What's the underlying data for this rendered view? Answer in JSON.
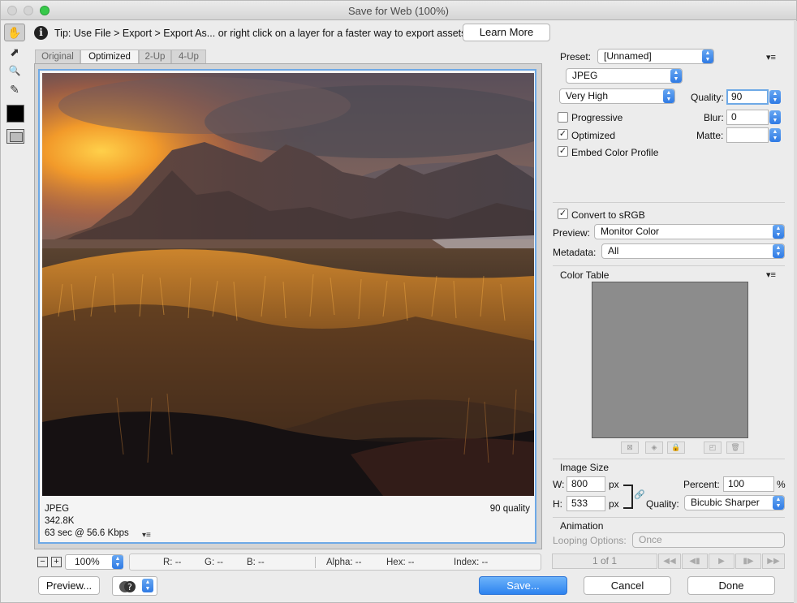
{
  "window": {
    "title": "Save for Web (100%)"
  },
  "tools": [
    {
      "name": "hand-tool",
      "glyph": "✋"
    },
    {
      "name": "slice-select-tool",
      "glyph": "⬈"
    },
    {
      "name": "zoom-tool",
      "glyph": "🔍"
    },
    {
      "name": "eyedropper-tool",
      "glyph": "✎"
    }
  ],
  "tip": {
    "icon": "i",
    "text": "Tip: Use File > Export > Export As...  or right click on a layer for a faster way to export assets",
    "button": "Learn More"
  },
  "tabs": [
    "Original",
    "Optimized",
    "2-Up",
    "4-Up"
  ],
  "selected_tab": "Optimized",
  "image_info": {
    "format": "JPEG",
    "size": "342.8K",
    "time": "63 sec @ 56.6 Kbps",
    "quality": "90 quality",
    "menu_glyph": "▾≡"
  },
  "status": {
    "zoom_minus": "−",
    "zoom_plus": "+",
    "zoom": "100%",
    "r": "R: --",
    "g": "G: --",
    "b": "B: --",
    "alpha": "Alpha: --",
    "hex": "Hex: --",
    "index": "Index: --"
  },
  "buttons": {
    "preview": "Preview...",
    "save": "Save...",
    "cancel": "Cancel",
    "done": "Done"
  },
  "settings": {
    "preset_label": "Preset:",
    "preset_value": "[Unnamed]",
    "format": "JPEG",
    "quality_preset": "Very High",
    "quality_label": "Quality:",
    "quality_value": "90",
    "progressive_label": "Progressive",
    "progressive": false,
    "blur_label": "Blur:",
    "blur_value": "0",
    "optimized_label": "Optimized",
    "optimized": true,
    "matte_label": "Matte:",
    "matte_value": "",
    "embed_profile_label": "Embed Color Profile",
    "embed_profile": true,
    "convert_srgb_label": "Convert to sRGB",
    "convert_srgb": true,
    "preview_label": "Preview:",
    "preview_value": "Monitor Color",
    "metadata_label": "Metadata:",
    "metadata_value": "All",
    "menu_glyph": "▾≡"
  },
  "color_table": {
    "title": "Color Table",
    "icons": [
      "⊠",
      "◈",
      "🔒",
      "◰",
      "🗑"
    ]
  },
  "image_size": {
    "title": "Image Size",
    "w_label": "W:",
    "w_value": "800",
    "h_label": "H:",
    "h_value": "533",
    "unit": "px",
    "percent_label": "Percent:",
    "percent_value": "100",
    "percent_unit": "%",
    "quality_label": "Quality:",
    "quality_value": "Bicubic Sharper",
    "link_glyph": "🔗"
  },
  "animation": {
    "title": "Animation",
    "looping_label": "Looping Options:",
    "looping_value": "Once",
    "frame_count": "1 of 1",
    "controls": [
      "◀◀",
      "◀▮",
      "▶",
      "▮▶",
      "▶▶"
    ]
  },
  "help": {
    "glyph": "?"
  },
  "colors": {
    "accent": "#2d83ef",
    "focus": "#6ea9e6",
    "swatch": "#000000",
    "color_table_bg": "#8c8c8c"
  }
}
